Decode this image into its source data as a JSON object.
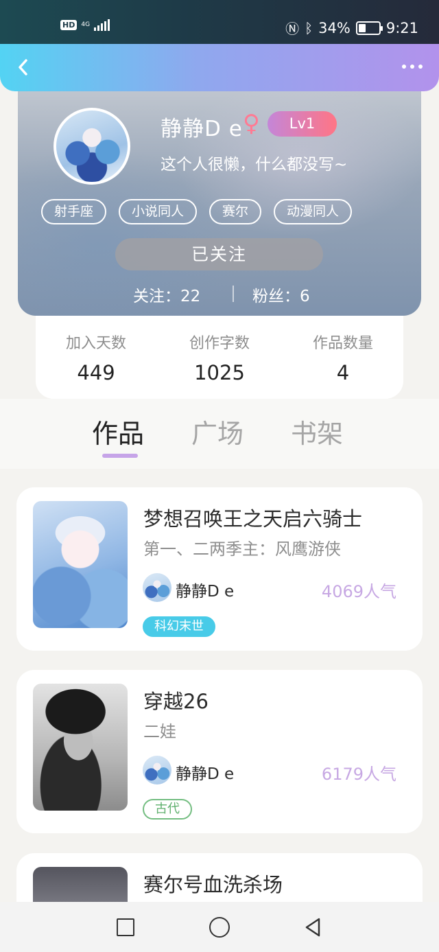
{
  "status_bar": {
    "hd": "HD",
    "network": "4G",
    "battery": "34%",
    "time": "9:21"
  },
  "profile": {
    "nickname": "静静D e",
    "gender_symbol": "♀",
    "level": "Lv1",
    "bio": "这个人很懒，什么都没写~",
    "tags": [
      "射手座",
      "小说同人",
      "赛尔",
      "动漫同人"
    ],
    "follow_button": "已关注",
    "following": "关注：22",
    "fans": "粉丝：6"
  },
  "stats": [
    {
      "label": "加入天数",
      "value": "449"
    },
    {
      "label": "创作字数",
      "value": "1025"
    },
    {
      "label": "作品数量",
      "value": "4"
    }
  ],
  "tabs": [
    {
      "label": "作品",
      "active": true
    },
    {
      "label": "广场",
      "active": false
    },
    {
      "label": "书架",
      "active": false
    }
  ],
  "works": [
    {
      "title": "梦想召唤王之天启六骑士",
      "subtitle": "第一、二两季主：风鹰游侠",
      "author": "静静D e",
      "popularity": "4069人气",
      "genre": "科幻末世"
    },
    {
      "title": "穿越26",
      "subtitle": "二娃",
      "author": "静静D e",
      "popularity": "6179人气",
      "genre": "古代"
    },
    {
      "title": "赛尔号血洗杀场"
    }
  ],
  "colors": {
    "header_gradient_start": "#53d3f3",
    "header_gradient_end": "#b292ec",
    "level_badge_start": "#c486d8",
    "level_badge_end": "#ff7585",
    "popularity": "#c7a8e3",
    "genre_scifi": "#48cbe8",
    "genre_ancient": "#73bd80",
    "tab_indicator": "#c6a4e8"
  },
  "icons": [
    "back-icon",
    "more-icon",
    "female-icon",
    "nfc-icon",
    "bluetooth-icon",
    "battery-icon",
    "signal-icon"
  ]
}
